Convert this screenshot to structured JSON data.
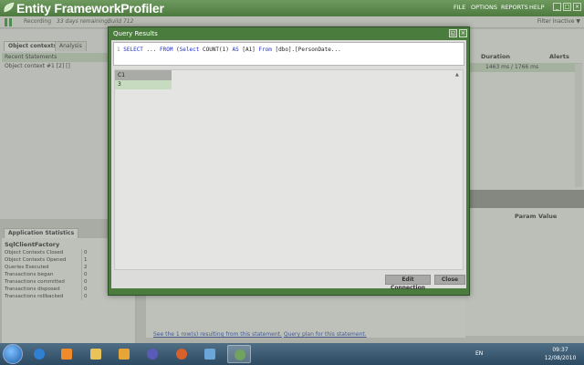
{
  "app": {
    "title": "Entity FrameworkProfiler",
    "menu": [
      "FILE",
      "OPTIONS",
      "REPORTS",
      "HELP"
    ]
  },
  "status": {
    "recording": "Recording",
    "days_remaining": "33 days remaining,",
    "build": "Build 712",
    "filter": "Filter Inactive"
  },
  "left": {
    "tabs": [
      "Object contexts",
      "Analysis"
    ],
    "items": [
      "Recent Statements",
      "Object context #1   [2]  []"
    ]
  },
  "stats": {
    "tab": "Application Statistics",
    "heading": "SqlClientFactory",
    "rows": [
      {
        "label": "Object Contexts Closed",
        "value": "0"
      },
      {
        "label": "Object Contexts Opened",
        "value": "1"
      },
      {
        "label": "Queries Executed",
        "value": "2"
      },
      {
        "label": "Transactions began",
        "value": "0"
      },
      {
        "label": "Transactions committed",
        "value": "0"
      },
      {
        "label": "Transactions disposed",
        "value": "0"
      },
      {
        "label": "Transactions rollbacked",
        "value": "0"
      }
    ]
  },
  "right": {
    "duration_header": "Duration",
    "alerts_header": "Alerts",
    "duration_value": "1463 ms / 1766 ms",
    "param_header": "Param",
    "value_header": "Value"
  },
  "bottom": {
    "link1": "See the 1 row(s) resulting from this statement.",
    "link2": "Query plan for this statement."
  },
  "dialog": {
    "title": "Query Results",
    "sql_line_no": "1",
    "sql": {
      "k1": "SELECT",
      "t1": " ... ",
      "k2": "FROM",
      "t2": " (",
      "k3": "Select",
      "t3": " COUNT(1) ",
      "k4": "AS",
      "t4": " [A1] ",
      "k5": "From",
      "t5": " [dbo].[PersonDate..."
    },
    "grid": {
      "header": "C1",
      "value": "3"
    },
    "buttons": {
      "edit": "Edit Connection",
      "close": "Close"
    }
  },
  "taskbar": {
    "lang": "EN",
    "time": "09:37",
    "date": "12/08/2010"
  }
}
